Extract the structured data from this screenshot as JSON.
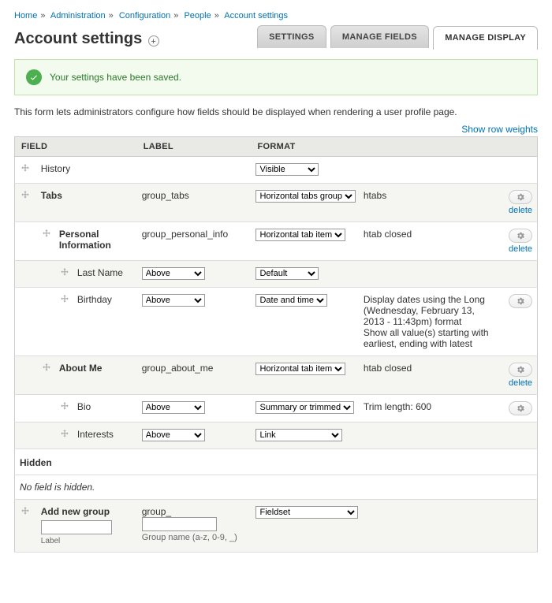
{
  "breadcrumb": {
    "home": "Home",
    "admin": "Administration",
    "config": "Configuration",
    "people": "People",
    "account": "Account settings"
  },
  "page_title": "Account settings",
  "tabs": {
    "settings": "SETTINGS",
    "manage_fields": "MANAGE FIELDS",
    "manage_display": "MANAGE DISPLAY"
  },
  "status_message": "Your settings have been saved.",
  "intro_text": "This form lets administrators configure how fields should be displayed when rendering a user profile page.",
  "show_row_weights": "Show row weights",
  "columns": {
    "field": "FIELD",
    "label": "LABEL",
    "format": "FORMAT"
  },
  "rows": {
    "history": {
      "name": "History",
      "format": "Visible"
    },
    "tabs": {
      "name": "Tabs",
      "label": "group_tabs",
      "format": "Horizontal tabs group",
      "summary": "htabs",
      "delete": "delete"
    },
    "personal": {
      "name": "Personal Information",
      "label": "group_personal_info",
      "format": "Horizontal tab item",
      "summary": "htab closed",
      "delete": "delete"
    },
    "lastname": {
      "name": "Last Name",
      "labelpos": "Above",
      "format": "Default"
    },
    "birthday": {
      "name": "Birthday",
      "labelpos": "Above",
      "format": "Date and time",
      "summary_l1": "Display dates using the Long (Wednesday, February 13, 2013 - 11:43pm) format",
      "summary_l2": "Show all value(s) starting with earliest, ending with latest"
    },
    "aboutme": {
      "name": "About Me",
      "label": "group_about_me",
      "format": "Horizontal tab item",
      "summary": "htab closed",
      "delete": "delete"
    },
    "bio": {
      "name": "Bio",
      "labelpos": "Above",
      "format": "Summary or trimmed",
      "summary": "Trim length: 600"
    },
    "interests": {
      "name": "Interests",
      "labelpos": "Above",
      "format": "Link"
    }
  },
  "hidden_heading": "Hidden",
  "hidden_empty": "No field is hidden.",
  "addgroup": {
    "title": "Add new group",
    "prefix": "group_",
    "hint": "Group name (a-z, 0-9, _)",
    "format": "Fieldset",
    "label_caption": "Label"
  }
}
